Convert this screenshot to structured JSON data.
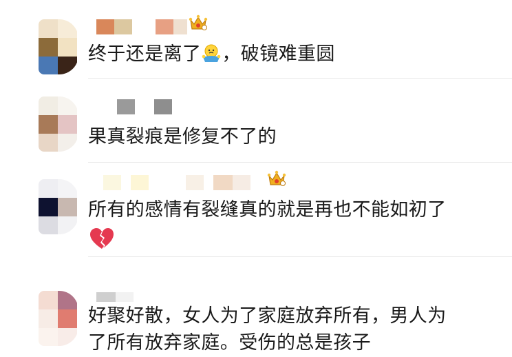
{
  "comments": [
    {
      "text_before": "终于还是离了",
      "emoji": "shrug-emoji",
      "text_after": "，破镜难重圆",
      "badge": "crown-icon"
    },
    {
      "text": "果真裂痕是修复不了的"
    },
    {
      "text": "所有的感情有裂缝真的就是再也不能如初了",
      "emoji": "broken-heart-emoji",
      "badge": "crown-icon"
    },
    {
      "line1": "好聚好散，女人为了家庭放弃所有，男人为",
      "line2": "了所有放弃家庭。受伤的总是孩子"
    }
  ],
  "colors": {
    "text": "#1a1a1a",
    "divider": "#e9e9e9",
    "crown": "#f0b020",
    "heart": "#e53950"
  }
}
